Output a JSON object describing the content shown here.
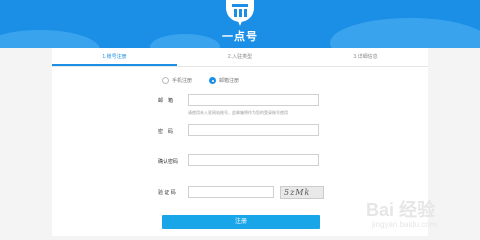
{
  "brand": {
    "name": "一点号"
  },
  "steps": [
    "1.账号注册",
    "2.入驻类型",
    "3.详细信息"
  ],
  "register_options": {
    "phone": "手机注册",
    "email": "邮箱注册",
    "selected": "email"
  },
  "form": {
    "email_label": "邮　箱",
    "email_hint": "请使用未入驻网站账号，此邮箱将作为您的登录账号使用",
    "password_label": "密　码",
    "confirm_label": "确认密码",
    "captcha_label": "验 证 码",
    "captcha_text": "5zMk",
    "submit_label": "注册"
  },
  "watermark": {
    "big": "Bai 经验",
    "small": "jingyan.baidu.com"
  },
  "colors": {
    "accent": "#1b8fe6",
    "button": "#19a6e8"
  }
}
